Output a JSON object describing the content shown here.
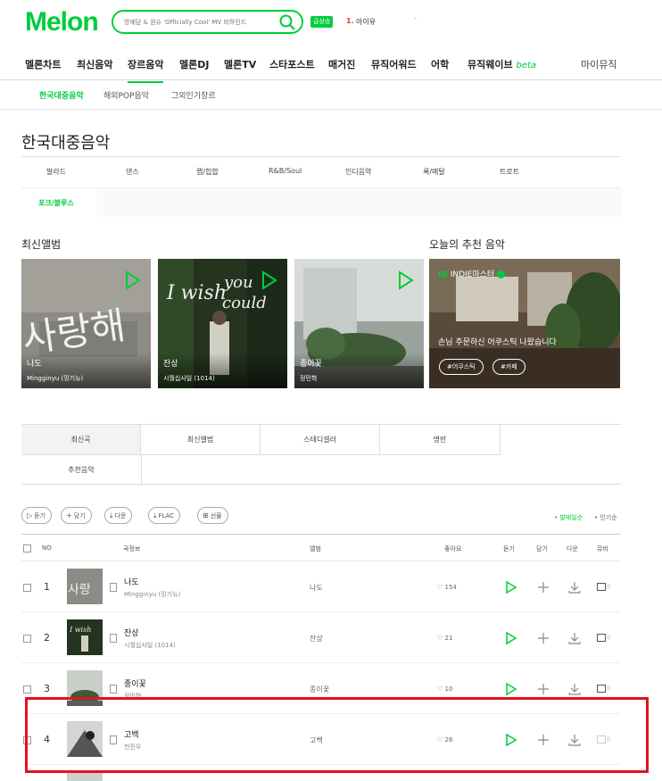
{
  "header": {
    "logo": "Melon",
    "search_placeholder": "방예담 & 원슈 'Officially Cool' MV 비하인드",
    "rise_badge": "급상승",
    "rank_num": "1.",
    "rank_title": "아이유",
    "rank_dash": "-"
  },
  "gnb": {
    "items": [
      "멜론차트",
      "최신음악",
      "장르음악",
      "멜론DJ",
      "멜론TV",
      "스타포스트",
      "매거진",
      "뮤직어워드",
      "어학",
      "뮤직웨이브"
    ],
    "beta": "beta",
    "mymusic": "마이뮤직"
  },
  "subnav": [
    "한국대중음악",
    "해외POP음악",
    "그외인기장르"
  ],
  "page_title": "한국대중음악",
  "genres": [
    "발라드",
    "댄스",
    "랩/힙합",
    "R&B/Soul",
    "인디음악",
    "록/메탈",
    "트로트",
    "포크/블루스"
  ],
  "sections": {
    "new_albums": "최신앨범",
    "today_rec": "오늘의 추천 음악"
  },
  "albums": [
    {
      "title": "나도",
      "artist": "Mingginyu (밍기뉴)"
    },
    {
      "title": "잔상",
      "artist": "시월십사일 (1014)"
    },
    {
      "title": "종이꽃",
      "artist": "정민혁"
    }
  ],
  "recommendation": {
    "dj_tag": "DJ",
    "dj_name": "INDIE마스터",
    "title": "손님 주문하신 어쿠스틱 나왔습니다",
    "tags": [
      "#어쿠스틱",
      "#카페"
    ]
  },
  "tabs": [
    "최신곡",
    "최신앨범",
    "스테디셀러",
    "명반",
    "추천음악"
  ],
  "toolbar": {
    "buttons": [
      {
        "icon": "▷",
        "label": "듣기"
      },
      {
        "icon": "+",
        "label": "담기"
      },
      {
        "icon": "⤓",
        "label": "다운"
      },
      {
        "icon": "⤓",
        "label": "FLAC"
      },
      {
        "icon": "⊞",
        "label": "선물"
      }
    ],
    "sort_new": "• 발매일순",
    "sort_pop": "• 인기순"
  },
  "table_headers": {
    "no": "NO",
    "song_info": "곡정보",
    "album": "앨범",
    "like": "좋아요",
    "listen": "듣기",
    "add": "담기",
    "down": "다운",
    "mv": "뮤비"
  },
  "songs": [
    {
      "rank": "1",
      "title": "나도",
      "artist": "Mingginyu (밍기뉴)",
      "album": "나도",
      "likes": "154",
      "mv": "0"
    },
    {
      "rank": "2",
      "title": "잔상",
      "artist": "시월십사일 (1014)",
      "album": "잔상",
      "likes": "21",
      "mv": "0"
    },
    {
      "rank": "3",
      "title": "종이꽃",
      "artist": "정민혁",
      "album": "종이꽃",
      "likes": "10",
      "mv": "0"
    },
    {
      "rank": "4",
      "title": "고백",
      "artist": "천진우",
      "album": "고백",
      "likes": "26",
      "mv": "0"
    }
  ],
  "colors": {
    "brand": "#00cd3c",
    "highlight": "#e0141e"
  }
}
